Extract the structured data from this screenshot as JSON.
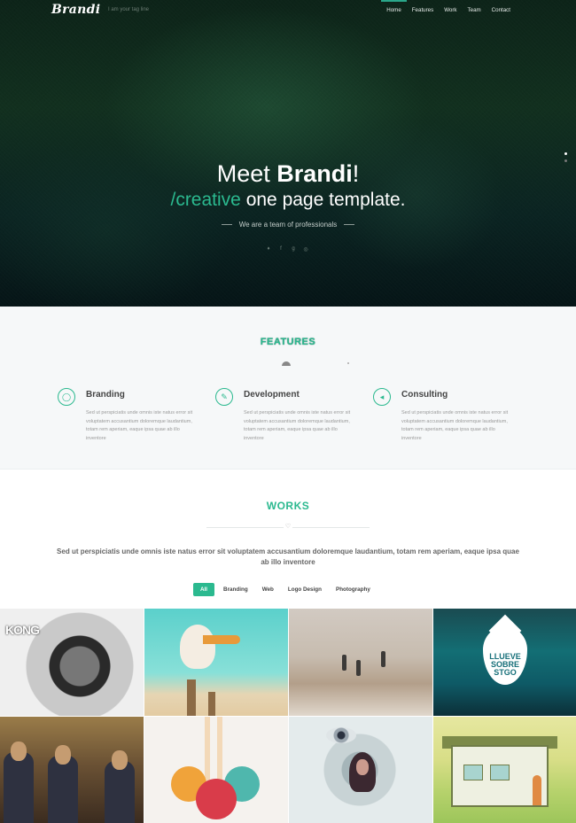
{
  "header": {
    "logo": "Brandi",
    "tagline": "I am your tag line",
    "nav": [
      {
        "label": "Home",
        "active": true
      },
      {
        "label": "Features",
        "active": false
      },
      {
        "label": "Work",
        "active": false
      },
      {
        "label": "Team",
        "active": false
      },
      {
        "label": "Contact",
        "active": false
      }
    ]
  },
  "hero": {
    "title_pre": "Meet ",
    "title_bold": "Brandi",
    "title_post": "!",
    "subtitle_accent": "/creative",
    "subtitle_rest": " one page template.",
    "line": "We are a team of professionals",
    "social_icons": [
      "twitter-icon",
      "facebook-icon",
      "google-plus-icon",
      "dribbble-icon"
    ],
    "slides": 2,
    "active_slide": 1
  },
  "features": {
    "title": "FEATURES",
    "items": [
      {
        "icon": "github-icon",
        "glyph": "◯",
        "title": "Branding",
        "text": "Sed ut perspiciatis unde omnis iste natus error sit voluptatem accusantium doloremque laudantium, totam rem aperiam, eaque ipsa quae ab illo inventore"
      },
      {
        "icon": "pencil-icon",
        "glyph": "✎",
        "title": "Development",
        "text": "Sed ut perspiciatis unde omnis iste natus error sit voluptatem accusantium doloremque laudantium, totam rem aperiam, eaque ipsa quae ab illo inventore"
      },
      {
        "icon": "megaphone-icon",
        "glyph": "◂",
        "title": "Consulting",
        "text": "Sed ut perspiciatis unde omnis iste natus error sit voluptatem accusantium doloremque laudantium, totam rem aperiam, eaque ipsa quae ab illo inventore"
      }
    ]
  },
  "works": {
    "title": "WORKS",
    "heart_icon": "heart-icon",
    "text": "Sed ut perspiciatis unde omnis iste natus error sit voluptatem accusantium doloremque laudantium, totam rem aperiam, eaque ipsa quae ab illo inventore",
    "filters": [
      {
        "label": "All",
        "active": true
      },
      {
        "label": "Branding",
        "active": false
      },
      {
        "label": "Web",
        "active": false
      },
      {
        "label": "Logo Design",
        "active": false
      },
      {
        "label": "Photography",
        "active": false
      }
    ]
  },
  "gallery": {
    "tile1_text": "KONG",
    "tile4_text_1": "LLUEVE",
    "tile4_text_2": "SOBRE",
    "tile4_text_3": "STGO"
  }
}
